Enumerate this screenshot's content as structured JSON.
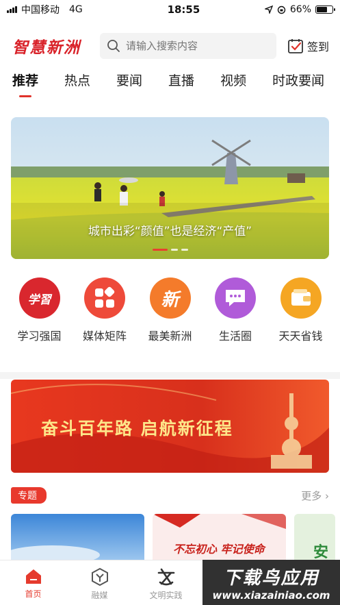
{
  "status_bar": {
    "carrier": "中国移动",
    "network": "4G",
    "time": "18:55",
    "battery": "66%",
    "battery_level": 0.66
  },
  "header": {
    "logo": "智慧新洲",
    "search_placeholder": "请输入搜索内容",
    "checkin_label": "签到"
  },
  "tabs": [
    {
      "label": "推荐",
      "active": true
    },
    {
      "label": "热点"
    },
    {
      "label": "要闻"
    },
    {
      "label": "直播"
    },
    {
      "label": "视频"
    },
    {
      "label": "时政要闻"
    }
  ],
  "banner": {
    "caption": "城市出彩“颜值”也是经济“产值”",
    "slide_count": 3,
    "active_slide": 1
  },
  "quick_links": [
    {
      "label": "学习强国",
      "color": "#d9272e",
      "icon": "xuexi-icon",
      "glyph": "学習"
    },
    {
      "label": "媒体矩阵",
      "color": "#ee4a3a",
      "icon": "matrix-icon"
    },
    {
      "label": "最美新洲",
      "color": "#f47b2b",
      "icon": "xin-icon",
      "glyph": "新"
    },
    {
      "label": "生活圈",
      "color": "#b05bd9",
      "icon": "chat-icon"
    },
    {
      "label": "天天省钱",
      "color": "#f5a623",
      "icon": "wallet-icon"
    }
  ],
  "promo": {
    "slogan": "奋斗百年路  启航新征程"
  },
  "special": {
    "tag": "专题",
    "more": "更多 ›",
    "card2_text": "不忘初心  牢记使命",
    "card3_text": "安"
  },
  "bottom_nav": [
    {
      "label": "首页",
      "active": true,
      "icon": "home-icon"
    },
    {
      "label": "融媒",
      "icon": "media-icon"
    },
    {
      "label": "文明实践",
      "icon": "civilization-icon"
    }
  ],
  "watermark": {
    "title": "下载鸟应用",
    "url": "www.xiazainiao.com"
  }
}
